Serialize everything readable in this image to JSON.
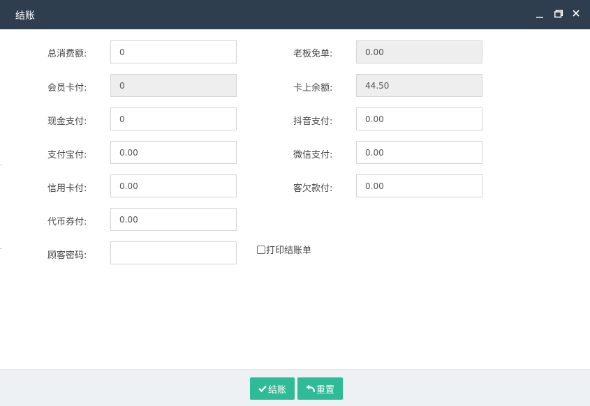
{
  "dialog": {
    "title": "结账"
  },
  "fields": {
    "total_consumption": {
      "label": "总消费额:",
      "value": "0"
    },
    "boss_waiver": {
      "label": "老板免单:",
      "value": "0.00"
    },
    "member_card_pay": {
      "label": "会员卡付:",
      "value": "0"
    },
    "card_balance": {
      "label": "卡上余额:",
      "value": "44.50"
    },
    "cash_pay": {
      "label": "现金支付:",
      "value": "0"
    },
    "douyin_pay": {
      "label": "抖音支付:",
      "value": "0.00"
    },
    "alipay_pay": {
      "label": "支付宝付:",
      "value": "0.00"
    },
    "wechat_pay": {
      "label": "微信支付:",
      "value": "0.00"
    },
    "credit_card_pay": {
      "label": "信用卡付:",
      "value": "0.00"
    },
    "customer_debt": {
      "label": "客欠款付:",
      "value": "0.00"
    },
    "token_voucher_pay": {
      "label": "代币券付:",
      "value": "0.00"
    },
    "customer_password": {
      "label": "顾客密码:",
      "value": ""
    }
  },
  "print_receipt": {
    "label": "打印结账单",
    "checked": false
  },
  "footer": {
    "settle_label": "结账",
    "reset_label": "重置"
  },
  "colors": {
    "titlebar": "#2f3e4e",
    "accent_button": "#2dbb98",
    "footer_bg": "#eef1f4",
    "readonly_bg": "#eeeeee"
  },
  "icons": [
    "minimize-icon",
    "maximize-icon",
    "close-icon",
    "check-icon",
    "undo-icon"
  ]
}
